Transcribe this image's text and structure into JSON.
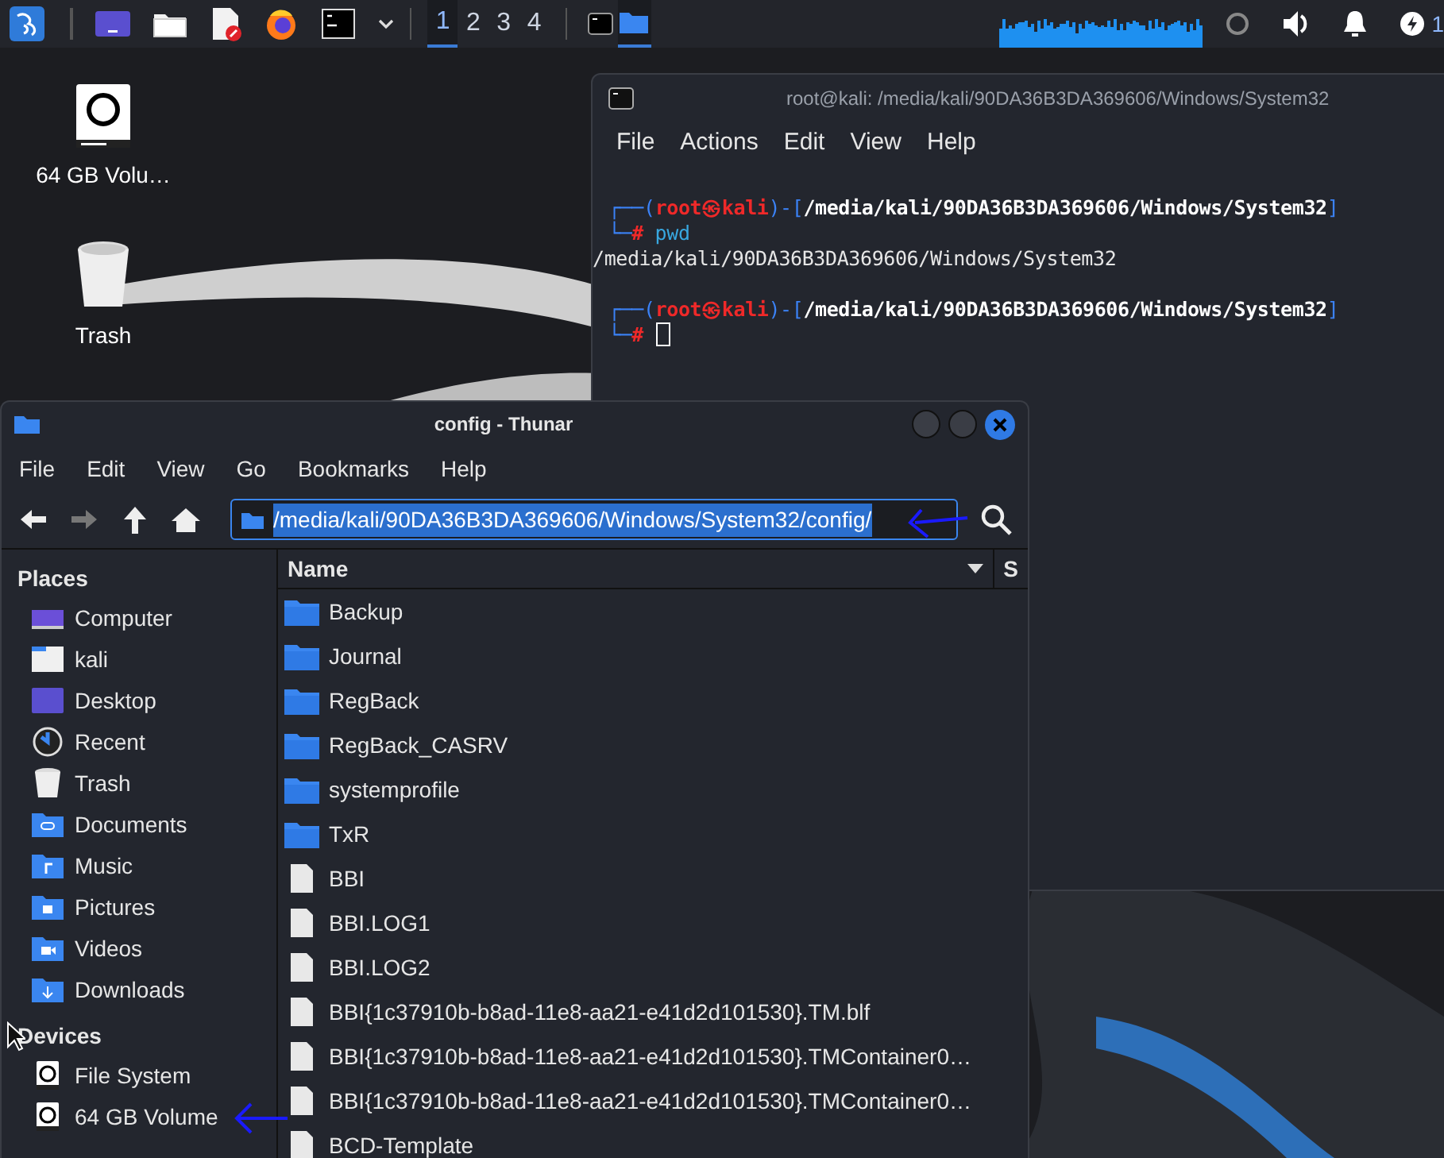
{
  "taskbar": {
    "launchers": [
      {
        "kind": "menu"
      },
      {
        "kind": "desktop"
      },
      {
        "kind": "files"
      },
      {
        "kind": "editor"
      },
      {
        "kind": "browser"
      },
      {
        "kind": "terminal"
      },
      {
        "kind": "caret"
      }
    ],
    "workspaces": [
      {
        "label": "1",
        "selected": true
      },
      {
        "label": "2",
        "selected": false
      },
      {
        "label": "3",
        "selected": false
      },
      {
        "label": "4",
        "selected": false
      }
    ],
    "tasks": [
      {
        "kind": "terminal",
        "selected": false
      },
      {
        "kind": "files",
        "selected": true
      }
    ],
    "tray": [
      {
        "kind": "spinner"
      },
      {
        "kind": "volume"
      },
      {
        "kind": "bell"
      },
      {
        "kind": "power"
      }
    ],
    "clock": "1"
  },
  "desktop_icons": [
    {
      "kind": "drive",
      "label": "64 GB Volu…"
    },
    {
      "kind": "trash",
      "label": "Trash"
    }
  ],
  "terminal": {
    "title": "root@kali: /media/kali/90DA36B3DA369606/Windows/System32",
    "menu": [
      "File",
      "Actions",
      "Edit",
      "View",
      "Help"
    ],
    "lines": [
      {
        "kind": "prompt",
        "segments": [
          {
            "kind": "frame",
            "text": "┌──("
          },
          {
            "kind": "user",
            "text": "root㉿kali"
          },
          {
            "kind": "frame",
            "text": ")-["
          },
          {
            "kind": "path",
            "text": "/media/kali/90DA36B3DA369606/Windows/System32"
          },
          {
            "kind": "frame",
            "text": "]"
          }
        ]
      },
      {
        "kind": "prompt",
        "segments": [
          {
            "kind": "frame",
            "text": "└─"
          },
          {
            "kind": "user",
            "text": "#"
          },
          {
            "kind": "command",
            "text": " pwd"
          }
        ]
      },
      {
        "kind": "output",
        "segments": [
          {
            "kind": "output",
            "text": "/media/kali/90DA36B3DA369606/Windows/System32"
          }
        ]
      },
      {
        "kind": "blank"
      },
      {
        "kind": "prompt",
        "segments": [
          {
            "kind": "frame",
            "text": "┌──("
          },
          {
            "kind": "user",
            "text": "root㉿kali"
          },
          {
            "kind": "frame",
            "text": ")-["
          },
          {
            "kind": "path",
            "text": "/media/kali/90DA36B3DA369606/Windows/System32"
          },
          {
            "kind": "frame",
            "text": "]"
          }
        ]
      },
      {
        "kind": "prompt",
        "cursor": true,
        "segments": [
          {
            "kind": "frame",
            "text": "└─"
          },
          {
            "kind": "user",
            "text": "#"
          }
        ]
      }
    ]
  },
  "file_manager": {
    "title": "config - Thunar",
    "menu": [
      "File",
      "Edit",
      "View",
      "Go",
      "Bookmarks",
      "Help"
    ],
    "location": {
      "value": "/media/kali/90DA36B3DA369606/Windows/System32/config/",
      "selected": true
    },
    "sidebar": [
      {
        "heading": "Places",
        "items": [
          {
            "kind": "computer",
            "label": "Computer"
          },
          {
            "kind": "home",
            "label": "kali"
          },
          {
            "kind": "desktop",
            "label": "Desktop"
          },
          {
            "kind": "recent",
            "label": "Recent"
          },
          {
            "kind": "trash",
            "label": "Trash"
          },
          {
            "kind": "documents",
            "label": "Documents"
          },
          {
            "kind": "music",
            "label": "Music"
          },
          {
            "kind": "pictures",
            "label": "Pictures"
          },
          {
            "kind": "videos",
            "label": "Videos"
          },
          {
            "kind": "downloads",
            "label": "Downloads"
          }
        ]
      },
      {
        "heading": "Devices",
        "items": [
          {
            "kind": "drive",
            "label": "File System"
          },
          {
            "kind": "drive",
            "label": "64 GB Volume"
          }
        ]
      }
    ],
    "columns": [
      {
        "label": "Name",
        "sorted": true
      },
      {
        "label": "S",
        "sorted": false
      }
    ],
    "rows": [
      {
        "kind": "folder",
        "name": "Backup"
      },
      {
        "kind": "folder",
        "name": "Journal"
      },
      {
        "kind": "folder",
        "name": "RegBack"
      },
      {
        "kind": "folder",
        "name": "RegBack_CASRV"
      },
      {
        "kind": "folder",
        "name": "systemprofile"
      },
      {
        "kind": "folder",
        "name": "TxR"
      },
      {
        "kind": "file",
        "name": "BBI"
      },
      {
        "kind": "file",
        "name": "BBI.LOG1"
      },
      {
        "kind": "file",
        "name": "BBI.LOG2"
      },
      {
        "kind": "file",
        "name": "BBI{1c37910b-b8ad-11e8-aa21-e41d2d101530}.TM.blf"
      },
      {
        "kind": "file",
        "name": "BBI{1c37910b-b8ad-11e8-aa21-e41d2d101530}.TMContainer0…"
      },
      {
        "kind": "file",
        "name": "BBI{1c37910b-b8ad-11e8-aa21-e41d2d101530}.TMContainer0…"
      },
      {
        "kind": "file",
        "name": "BCD-Template"
      }
    ]
  }
}
